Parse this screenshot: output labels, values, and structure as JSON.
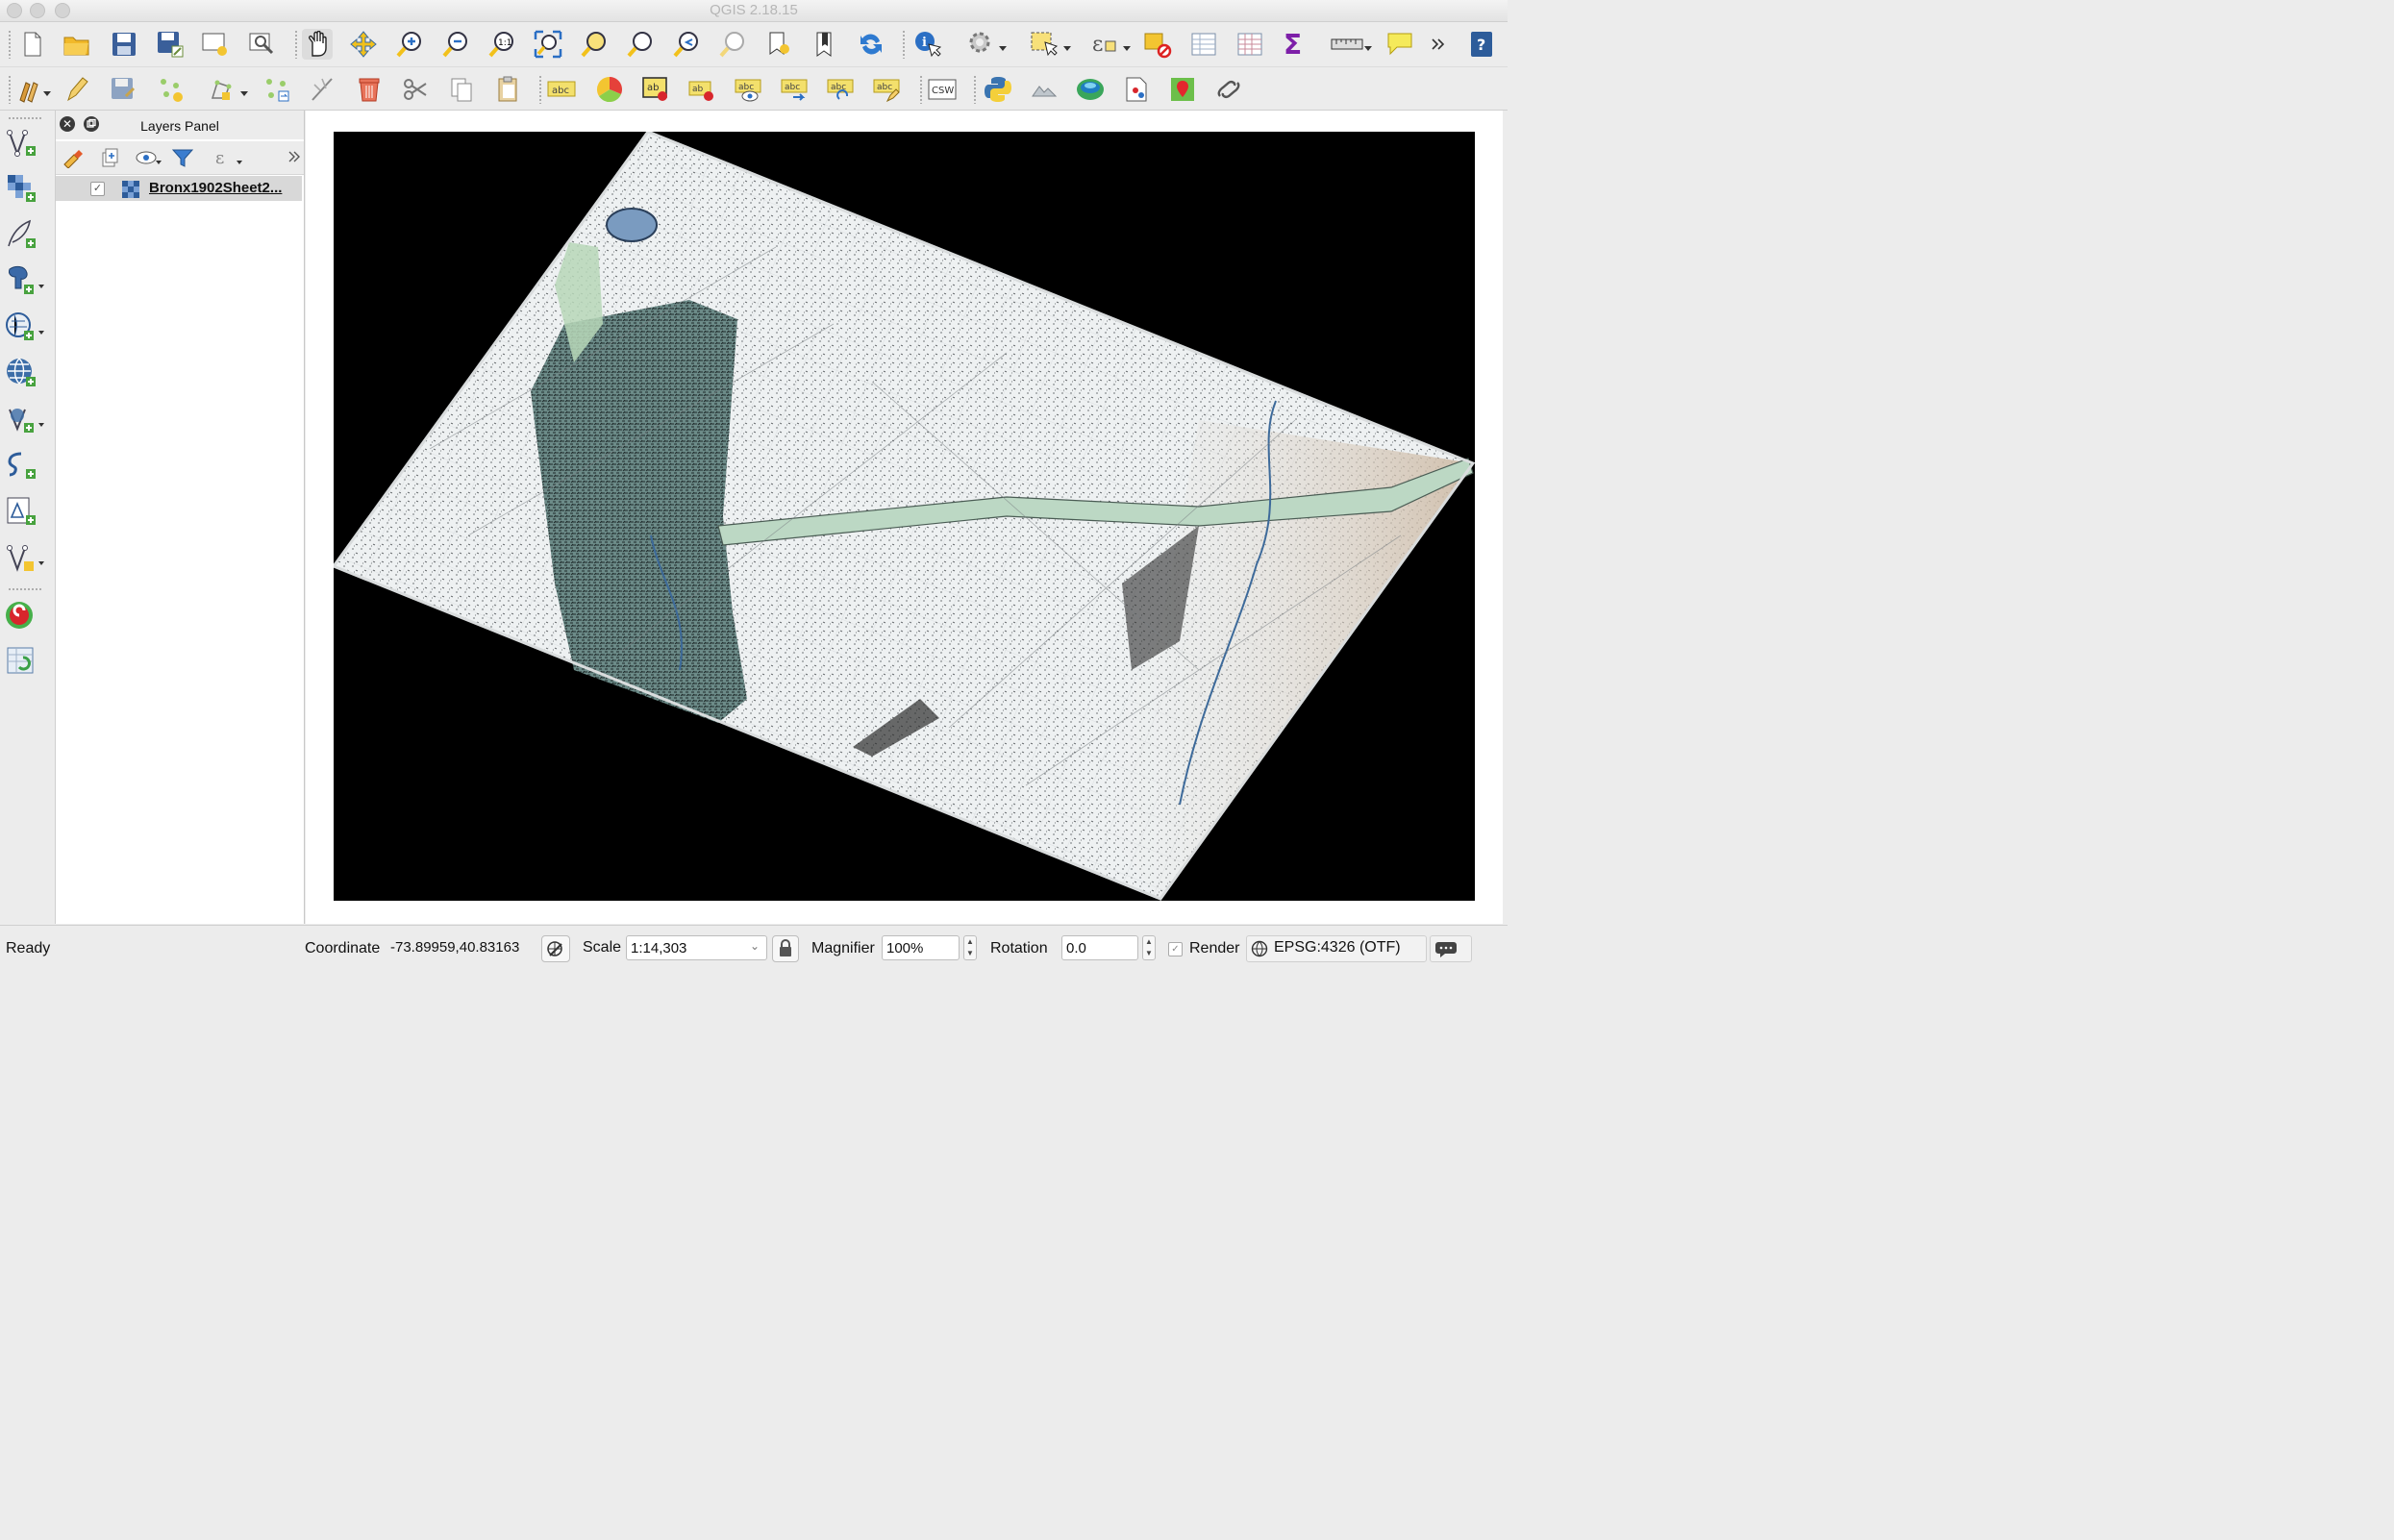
{
  "window": {
    "title": "QGIS 2.18.15"
  },
  "toolbar_top": {
    "icons": [
      "new-project-icon",
      "open-project-icon",
      "save-project-icon",
      "save-as-icon",
      "new-print-composer-icon",
      "composer-manager-icon",
      "pan-icon",
      "pan-to-selection-icon",
      "zoom-in-icon",
      "zoom-out-icon",
      "zoom-native-icon",
      "zoom-full-icon",
      "zoom-to-selection-icon",
      "zoom-to-layer-icon",
      "zoom-last-icon",
      "zoom-next-icon",
      "new-bookmark-icon",
      "show-bookmarks-icon",
      "refresh-icon",
      "identify-icon",
      "run-action-icon",
      "select-features-icon",
      "select-by-expression-icon",
      "deselect-all-icon",
      "attribute-table-icon",
      "field-calculator-icon",
      "statistical-summary-icon",
      "measure-icon",
      "map-tips-icon",
      "overflow-icon",
      "help-icon"
    ]
  },
  "toolbar_second": {
    "icons": [
      "current-edits-icon",
      "toggle-editing-icon",
      "save-edits-icon",
      "add-feature-icon",
      "move-feature-icon",
      "node-tool-icon",
      "digitize-icon",
      "delete-selected-icon",
      "cut-features-icon",
      "copy-features-icon",
      "paste-features-icon",
      "layer-labeling-icon",
      "diagram-options-icon",
      "pin-labels-icon",
      "highlight-pinned-labels-icon",
      "show-hide-labels-icon",
      "move-label-icon",
      "rotate-label-icon",
      "change-label-icon",
      "metasearch-icon",
      "python-console-icon",
      "georeferencer-icon",
      "globe-icon",
      "print-atlas-icon",
      "plugin-red-pin-icon",
      "plugin-link-icon"
    ],
    "csw_text": "CSW"
  },
  "sidebar": {
    "icons": [
      "add-vector-layer-icon",
      "add-raster-layer-icon",
      "add-delimited-text-icon",
      "add-postgis-layer-icon",
      "add-spatialite-layer-icon",
      "add-wms-layer-icon",
      "add-wfs-layer-icon",
      "add-virtual-layer-icon",
      "new-shapefile-icon",
      "new-temporary-layer-icon",
      "raster-plugin-icon",
      "refresh-table-icon"
    ]
  },
  "layers_panel": {
    "title": "Layers Panel",
    "tool_icons": [
      "style-icon",
      "add-group-icon",
      "manage-visibility-icon",
      "filter-legend-icon",
      "filter-expression-icon",
      "overflow-icon"
    ],
    "layers": [
      {
        "name": "Bronx1902Sheet2...",
        "checked": true
      }
    ]
  },
  "statusbar": {
    "ready": "Ready",
    "coordinate_label": "Coordinate",
    "coordinate_value": "-73.89959,40.83163",
    "scale_label": "Scale",
    "scale_value": "1:14,303",
    "magnifier_label": "Magnifier",
    "magnifier_value": "100%",
    "rotation_label": "Rotation",
    "rotation_value": "0.0",
    "render_label": "Render",
    "render_checked": true,
    "crs": "EPSG:4326 (OTF)"
  },
  "colors": {
    "map_background": "#000000",
    "map_paper": "#eef1f2",
    "green_zone": "#6c8b88",
    "road": "#bcd8c4"
  }
}
